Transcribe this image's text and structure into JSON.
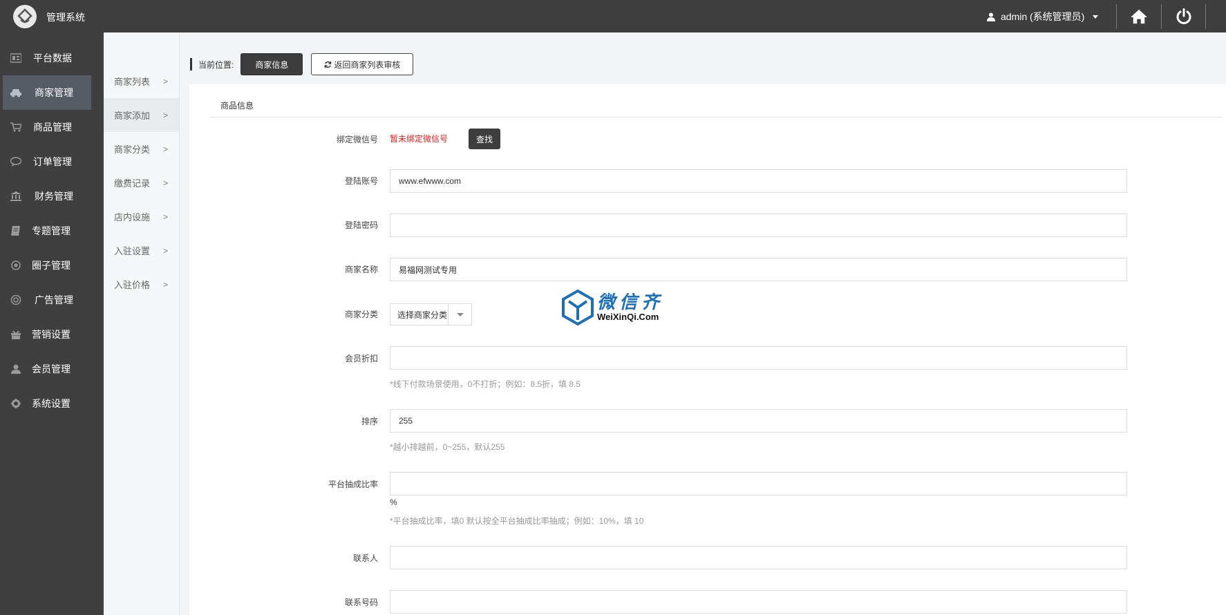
{
  "app": {
    "title": "管理系统"
  },
  "user": {
    "label": "admin (系统管理员)"
  },
  "sidebar": {
    "items": [
      {
        "label": "平台数据",
        "icon": "dashboard-icon"
      },
      {
        "label": "商家管理",
        "icon": "car-icon",
        "active": true
      },
      {
        "label": "商品管理",
        "icon": "cart-icon"
      },
      {
        "label": "订单管理",
        "icon": "comment-icon"
      },
      {
        "label": "财务管理",
        "icon": "bank-icon"
      },
      {
        "label": "专题管理",
        "icon": "book-icon"
      },
      {
        "label": "圈子管理",
        "icon": "circle-icon"
      },
      {
        "label": "广告管理",
        "icon": "lifebuoy-icon"
      },
      {
        "label": "营销设置",
        "icon": "gift-icon"
      },
      {
        "label": "会员管理",
        "icon": "user-icon"
      },
      {
        "label": "系统设置",
        "icon": "gear-icon"
      }
    ]
  },
  "subnav": {
    "items": [
      {
        "label": "商家列表"
      },
      {
        "label": "商家添加",
        "active": true
      },
      {
        "label": "商家分类"
      },
      {
        "label": "缴费记录"
      },
      {
        "label": "店内设施"
      },
      {
        "label": "入驻设置"
      },
      {
        "label": "入驻价格"
      }
    ]
  },
  "breadcrumb": {
    "label": "当前位置:",
    "current": "商家信息",
    "back": "返回商家列表审核"
  },
  "panel": {
    "title": "商品信息"
  },
  "form": {
    "wechat": {
      "label": "绑定微信号",
      "status": "暂未绑定微信号",
      "button": "查找"
    },
    "account": {
      "label": "登陆账号",
      "value": "www.efwww.com"
    },
    "password": {
      "label": "登陆密码",
      "value": ""
    },
    "name": {
      "label": "商家名称",
      "value": "易福网测试专用"
    },
    "category": {
      "label": "商家分类",
      "value": "选择商家分类"
    },
    "discount": {
      "label": "会员折扣",
      "value": "",
      "hint": "*线下付款场景使用，0不打折；例如：8.5折，填 8.5"
    },
    "sort": {
      "label": "排序",
      "value": "255",
      "hint": "*越小排越前，0~255，默认255"
    },
    "commission": {
      "label": "平台抽成比率",
      "value": "",
      "unit": "%",
      "hint": "*平台抽成比率，填0 默认按全平台抽成比率抽成；例如：10%，填 10"
    },
    "contact": {
      "label": "联系人",
      "value": ""
    },
    "phone": {
      "label": "联系号码",
      "value": ""
    }
  },
  "watermark": {
    "cn": "微信齐",
    "en": "WeiXinQi.Com"
  }
}
